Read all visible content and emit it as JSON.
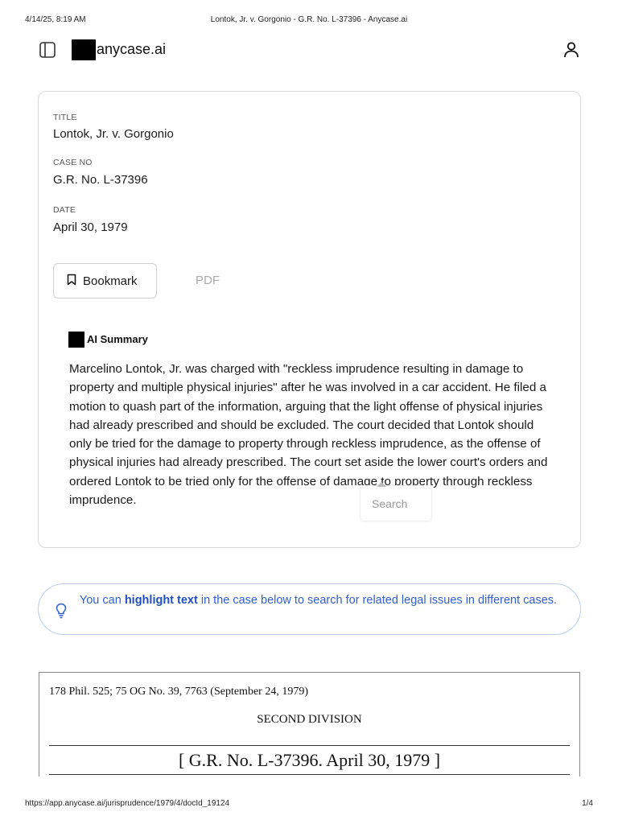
{
  "print_header": {
    "datetime": "4/14/25, 8:19 AM",
    "page_title": "Lontok, Jr. v. Gorgonio - G.R. No. L-37396 - Anycase.ai"
  },
  "topbar": {
    "logo_text": "anycase.ai",
    "sidebar_icon": "sidebar-toggle-icon",
    "user_icon": "user-icon"
  },
  "case": {
    "title_label": "TITLE",
    "title": "Lontok, Jr. v. Gorgonio",
    "case_no_label": "CASE NO",
    "case_no": "G.R. No. L-37396",
    "date_label": "DATE",
    "date": "April 30, 1979",
    "bookmark_label": "Bookmark",
    "pdf_label": "PDF"
  },
  "ai_summary": {
    "title": "AI Summary",
    "text": "Marcelino Lontok, Jr. was charged with \"reckless imprudence resulting in damage to property and multiple physical injuries\" after he was involved in a car accident. He filed a motion to quash part of the information, arguing that the light offense of physical injuries had already prescribed and should be excluded. The court decided that Lontok should only be tried for the damage to property through reckless imprudence, as the offense of physical injuries had already prescribed. The court set aside the lower court's orders and ordered Lontok to be tried only for the offense of damage to property through reckless imprudence."
  },
  "search_popup": {
    "label": "Search"
  },
  "tip": {
    "prefix": "You can",
    "highlight": "highlight text",
    "suffix": "in the case below to search for related legal issues in different cases.",
    "icon": "lightbulb-icon",
    "accent_color": "#2f5ecf"
  },
  "document": {
    "citation": "178 Phil. 525; 75 OG No. 39, 7763 (September 24, 1979)",
    "division": "SECOND DIVISION",
    "heading": "[ G.R. No. L-37396. April 30, 1979 ]"
  },
  "print_footer": {
    "url": "https://app.anycase.ai/jurisprudence/1979/4/docId_19124",
    "page": "1/4"
  }
}
